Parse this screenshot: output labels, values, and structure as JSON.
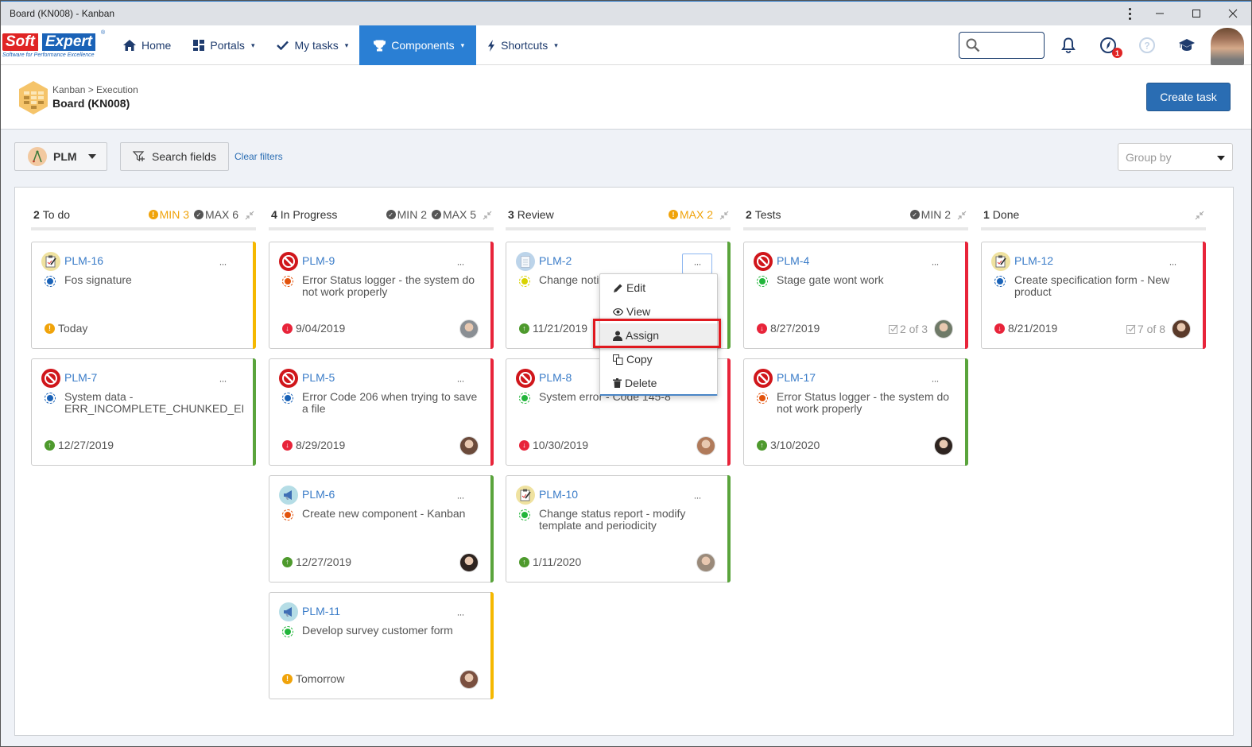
{
  "window": {
    "title": "Board (KN008) - Kanban",
    "controls": [
      "more-icon",
      "minimize-icon",
      "maximize-icon",
      "close-icon"
    ]
  },
  "navbar": {
    "logo": {
      "part1": "Soft",
      "part2": "Expert",
      "tagline": "Software for Performance Excellence",
      "reg": "®"
    },
    "items": [
      {
        "label": "Home",
        "icon": "home-icon",
        "dropdown": false,
        "active": false
      },
      {
        "label": "Portals",
        "icon": "grid-icon",
        "dropdown": true,
        "active": false
      },
      {
        "label": "My tasks",
        "icon": "check-icon",
        "dropdown": true,
        "active": false
      },
      {
        "label": "Components",
        "icon": "trophy-icon",
        "dropdown": true,
        "active": true
      },
      {
        "label": "Shortcuts",
        "icon": "bolt-icon",
        "dropdown": true,
        "active": false
      }
    ],
    "caret": "▾",
    "search": {
      "placeholder": "",
      "value": ""
    },
    "notifications_badge": "1"
  },
  "header": {
    "breadcrumb": "Kanban > Execution",
    "title": "Board (KN008)",
    "create_button": "Create task"
  },
  "filters": {
    "project": "PLM",
    "search_fields": "Search fields",
    "clear_filters": "Clear filters",
    "group_by_placeholder": "Group by"
  },
  "columns": [
    {
      "count": "2",
      "name": "To do",
      "limits": [
        {
          "label": "MIN 3",
          "state": "warn"
        },
        {
          "label": "MAX 6",
          "state": "ok"
        }
      ],
      "cards": [
        {
          "id": "PLM-16",
          "type": "clipboard",
          "status": "blue",
          "title": "Fos signature",
          "due": "Today",
          "due_state": "warn",
          "stripe": "#f5b800",
          "checklist": "",
          "avatar": ""
        },
        {
          "id": "PLM-7",
          "type": "block",
          "status": "blue",
          "title": "System data - ERR_INCOMPLETE_CHUNKED_EI",
          "due": "12/27/2019",
          "due_state": "ok",
          "stripe": "#5aa43c",
          "checklist": "",
          "avatar": ""
        }
      ]
    },
    {
      "count": "4",
      "name": "In Progress",
      "limits": [
        {
          "label": "MIN 2",
          "state": "ok"
        },
        {
          "label": "MAX 5",
          "state": "ok"
        }
      ],
      "cards": [
        {
          "id": "PLM-9",
          "type": "block",
          "status": "orange",
          "title": "Error Status logger - the system do not work properly",
          "due": "9/04/2019",
          "due_state": "late",
          "stripe": "#e8243a",
          "checklist": "",
          "avatar": "#8a8f94"
        },
        {
          "id": "PLM-5",
          "type": "block",
          "status": "blue",
          "title": "Error Code 206 when trying to save a file",
          "due": "8/29/2019",
          "due_state": "late",
          "stripe": "#e8243a",
          "checklist": "",
          "avatar": "#6b4a3a"
        },
        {
          "id": "PLM-6",
          "type": "megaphone",
          "status": "orange",
          "title": "Create new component - Kanban",
          "due": "12/27/2019",
          "due_state": "ok",
          "stripe": "#5aa43c",
          "checklist": "",
          "avatar": "#2e2420"
        },
        {
          "id": "PLM-11",
          "type": "megaphone",
          "status": "green",
          "title": "Develop survey customer form",
          "due": "Tomorrow",
          "due_state": "warn",
          "stripe": "#f5b800",
          "checklist": "",
          "avatar": "#7a5040"
        }
      ]
    },
    {
      "count": "3",
      "name": "Review",
      "limits": [
        {
          "label": "MAX 2",
          "state": "warn"
        }
      ],
      "cards": [
        {
          "id": "PLM-2",
          "type": "document",
          "status": "yellow",
          "title": "Change notification",
          "due": "11/21/2019",
          "due_state": "ok",
          "stripe": "#5aa43c",
          "checklist": "",
          "avatar": "",
          "menu_open": true
        },
        {
          "id": "PLM-8",
          "type": "block",
          "status": "green",
          "title": "System error - Code 145-8",
          "due": "10/30/2019",
          "due_state": "late",
          "stripe": "#e8243a",
          "checklist": "",
          "avatar": "#b07a5a"
        },
        {
          "id": "PLM-10",
          "type": "clipboard",
          "status": "green",
          "title": "Change status report - modify template and periodicity",
          "due": "1/11/2020",
          "due_state": "ok",
          "stripe": "#5aa43c",
          "checklist": "",
          "avatar": "#9a8a7a"
        }
      ]
    },
    {
      "count": "2",
      "name": "Tests",
      "limits": [
        {
          "label": "MIN 2",
          "state": "ok"
        }
      ],
      "cards": [
        {
          "id": "PLM-4",
          "type": "block",
          "status": "green",
          "title": "Stage gate wont work",
          "due": "8/27/2019",
          "due_state": "late",
          "stripe": "#e8243a",
          "checklist": "2 of 3",
          "avatar": "#6f7a68"
        },
        {
          "id": "PLM-17",
          "type": "block",
          "status": "orange",
          "title": "Error Status logger - the system do not work properly",
          "due": "3/10/2020",
          "due_state": "ok",
          "stripe": "#5aa43c",
          "checklist": "",
          "avatar": "#2e2420"
        }
      ]
    },
    {
      "count": "1",
      "name": "Done",
      "limits": [],
      "cards": [
        {
          "id": "PLM-12",
          "type": "clipboard",
          "status": "blue",
          "title": "Create specification form - New product",
          "due": "8/21/2019",
          "due_state": "late",
          "stripe": "#e8243a",
          "checklist": "7 of 8",
          "avatar": "#5a3a2a"
        }
      ]
    }
  ],
  "card_menu": {
    "items": [
      {
        "label": "Edit",
        "icon": "pencil-icon"
      },
      {
        "label": "View",
        "icon": "eye-icon"
      },
      {
        "label": "Assign",
        "icon": "user-icon",
        "highlighted": true
      },
      {
        "label": "Copy",
        "icon": "copy-icon"
      },
      {
        "label": "Delete",
        "icon": "trash-icon"
      }
    ],
    "ellipsis": "···"
  }
}
